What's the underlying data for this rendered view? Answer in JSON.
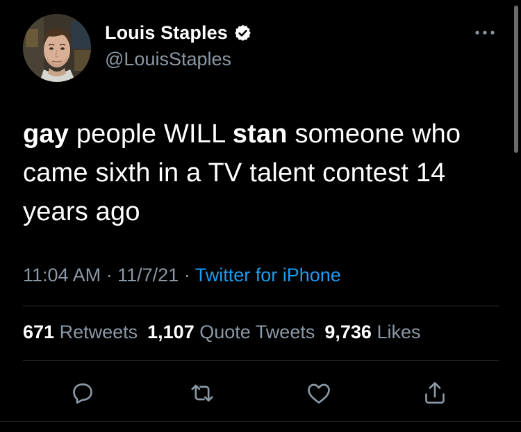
{
  "author": {
    "name": "Louis Staples",
    "handle": "@LouisStaples",
    "verified": true,
    "avatar": "avatar-photo"
  },
  "tweet": {
    "segments": [
      {
        "text": "gay",
        "bold": true
      },
      {
        "text": " people WILL ",
        "bold": false
      },
      {
        "text": "stan",
        "bold": true
      },
      {
        "text": " someone who came sixth in a TV talent contest 14 years ago",
        "bold": false
      }
    ],
    "time": "11:04 AM",
    "separator": "·",
    "date": "11/7/21",
    "source": "Twitter for iPhone"
  },
  "stats": {
    "retweets_count": "671",
    "retweets_label": "Retweets",
    "quote_tweets_count": "1,107",
    "quote_tweets_label": "Quote Tweets",
    "likes_count": "9,736",
    "likes_label": "Likes"
  },
  "actions": {
    "reply_icon": "speech-bubble-icon",
    "retweet_icon": "retweet-arrows-icon",
    "like_icon": "heart-icon",
    "share_icon": "share-upload-icon"
  },
  "colors": {
    "background": "#000000",
    "text": "#ffffff",
    "secondary": "#8b98a5",
    "link": "#1d9bf0",
    "divider": "#2f3336"
  }
}
